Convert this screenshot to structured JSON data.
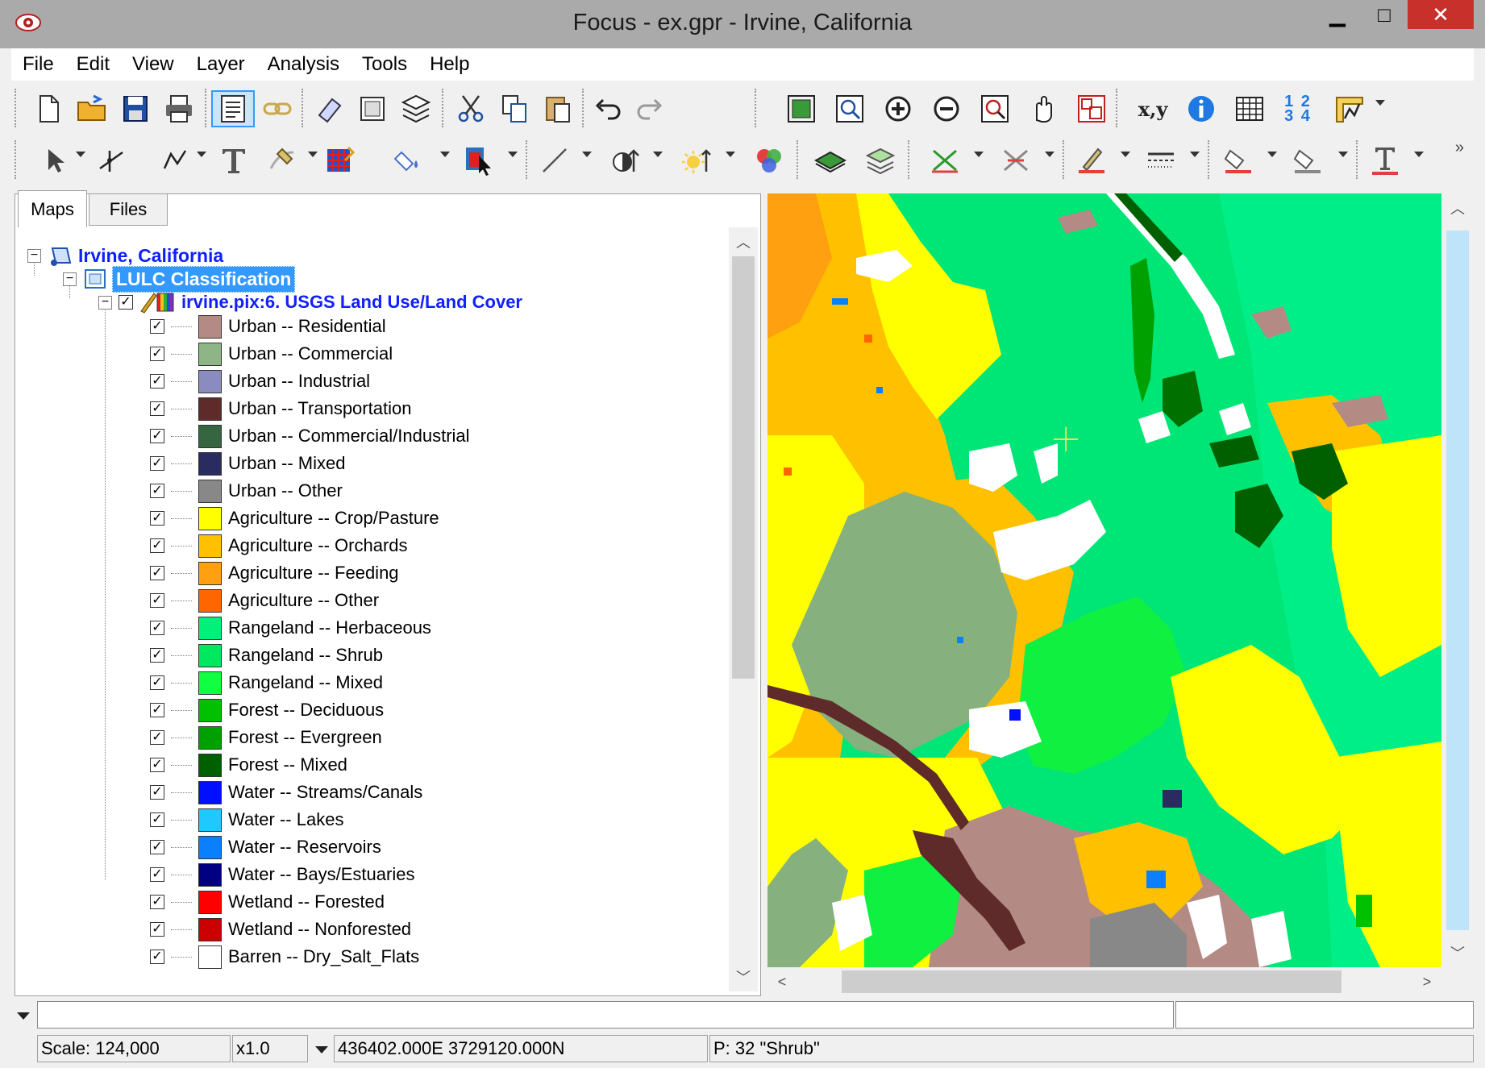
{
  "window": {
    "title": "Focus - ex.gpr - Irvine, California",
    "minimize": "▁",
    "maximize": "□",
    "close": "✕"
  },
  "menu": [
    "File",
    "Edit",
    "View",
    "Layer",
    "Analysis",
    "Tools",
    "Help"
  ],
  "toolbar": {
    "xy_label": "x,y",
    "numbers_label": "1 2 3 4"
  },
  "tabs": {
    "maps": "Maps",
    "files": "Files"
  },
  "tree": {
    "root": "Irvine, California",
    "area": "LULC Classification",
    "layer": "irvine.pix:6. USGS Land Use/Land Cover",
    "classes": [
      {
        "label": "Urban -- Residential",
        "color": "#b38b84"
      },
      {
        "label": "Urban -- Commercial",
        "color": "#8db585"
      },
      {
        "label": "Urban -- Industrial",
        "color": "#8a8cc0"
      },
      {
        "label": "Urban -- Transportation",
        "color": "#5e2a2a"
      },
      {
        "label": "Urban -- Commercial/Industrial",
        "color": "#356640"
      },
      {
        "label": "Urban -- Mixed",
        "color": "#2a2b5e"
      },
      {
        "label": "Urban -- Other",
        "color": "#888888"
      },
      {
        "label": "Agriculture -- Crop/Pasture",
        "color": "#ffff00"
      },
      {
        "label": "Agriculture -- Orchards",
        "color": "#ffc000"
      },
      {
        "label": "Agriculture -- Feeding",
        "color": "#ffa010"
      },
      {
        "label": "Agriculture -- Other",
        "color": "#ff6600"
      },
      {
        "label": "Rangeland -- Herbaceous",
        "color": "#00f07a"
      },
      {
        "label": "Rangeland -- Shrub",
        "color": "#00e860"
      },
      {
        "label": "Rangeland -- Mixed",
        "color": "#10ff40"
      },
      {
        "label": "Forest -- Deciduous",
        "color": "#00c000"
      },
      {
        "label": "Forest -- Evergreen",
        "color": "#00a000"
      },
      {
        "label": "Forest -- Mixed",
        "color": "#006000"
      },
      {
        "label": "Water -- Streams/Canals",
        "color": "#0010ff"
      },
      {
        "label": "Water -- Lakes",
        "color": "#20c8ff"
      },
      {
        "label": "Water -- Reservoirs",
        "color": "#0a80ff"
      },
      {
        "label": "Water -- Bays/Estuaries",
        "color": "#000080"
      },
      {
        "label": "Wetland -- Forested",
        "color": "#ff0000"
      },
      {
        "label": "Wetland -- Nonforested",
        "color": "#cc0000"
      },
      {
        "label": "Barren -- Dry_Salt_Flats",
        "color": "#ffffff"
      }
    ]
  },
  "status": {
    "scale": "Scale: 124,000",
    "zoom": "x1.0",
    "coords": "436402.000E 3729120.000N",
    "pixel": "P: 32 \"Shrub\""
  }
}
